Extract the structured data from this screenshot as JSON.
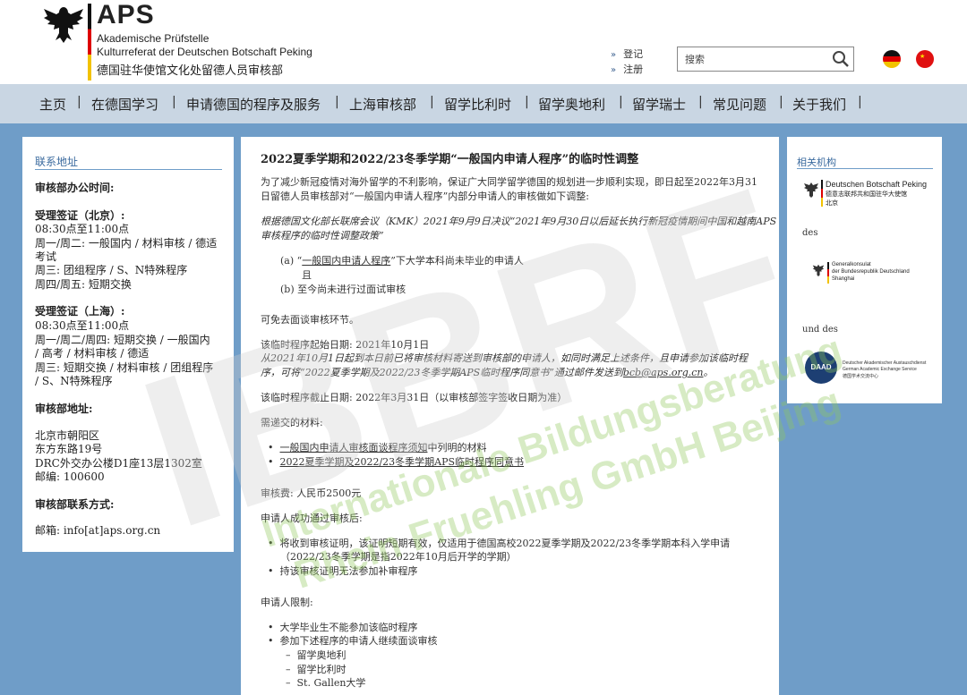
{
  "header": {
    "brand": "APS",
    "line1": "Akademische Prüfstelle",
    "line2": "Kulturreferat der Deutschen Botschaft Peking",
    "line_cn": "德国驻华使馆文化处留德人员审核部",
    "login": "登记",
    "register": "注册",
    "search_placeholder": "搜索"
  },
  "nav": [
    "主页",
    "在德国学习",
    "申请德国的程序及服务",
    "上海审核部",
    "留学比利时",
    "留学奥地利",
    "留学瑞士",
    "常见问题",
    "关于我们"
  ],
  "left": {
    "title": "联系地址",
    "office_hours": "审核部办公时间:",
    "bj_title": "受理签证（北京）:",
    "bj_time": "08:30点至11:00点",
    "bj_l1": "周一/周二: 一般国内 / 材料审核 / 德适",
    "bj_l2": "考试",
    "bj_l3": "周三: 团组程序 / S、N特殊程序",
    "bj_l4": "周四/周五: 短期交换",
    "sh_title": "受理签证（上海）:",
    "sh_time": "08:30点至11:00点",
    "sh_l1": "周一/周二/周四: 短期交换 / 一般国内",
    "sh_l2": "/ 高考 / 材料审核 / 德适",
    "sh_l3": "周三: 短期交换 / 材料审核 / 团组程序",
    "sh_l4": "/ S、N特殊程序",
    "addr_title": "审核部地址:",
    "addr1": "北京市朝阳区",
    "addr2": "东方东路19号",
    "addr3": "DRC外交办公楼D1座13层1302室",
    "addr4": "邮编:  100600",
    "contact_title": "审核部联系方式:",
    "email": "邮箱: info[at]aps.org.cn"
  },
  "main": {
    "title": "2022夏季学期和2022/23冬季学期“一般国内申请人程序”的临时性调整",
    "p1a": "为了减少新冠疫情对海外留学的不利影响，保证广大同学留学德国的规划进一步顺利实现，即日起至2022年3月31",
    "p1b": "日留德人员审核部对“一般国内申请人程序”内部分申请人的审核做如下调整:",
    "p2a": "根据德国文化部长联席会议（KMK）2021年9月9日决议“2021年9月30日以后延长执行新冠疫情期间中国和越南APS",
    "p2b": "审核程序的临时性调整政策”",
    "a_pre": "(a) “",
    "a_link": "一般国内申请人程序",
    "a_post": "”下大学本科尚未毕业的申请人",
    "and": "且",
    "b": "(b) 至今尚未进行过面试审核",
    "p3": "可免去面谈审核环节。",
    "start_label": "该临时程序起始日期:  2021年10月1日",
    "start_a": "从2021年10月1日起到本日前已将审核材料寄送到审核部的申请人，如同时满足上述条件，且申请参加该临时程",
    "start_b_pre": "序，可将“2022夏季学期及2022/23冬季学期APS临时程序同意书”通过邮件发送到",
    "start_b_link": "bcb@aps.org.cn",
    "start_b_post": "。",
    "end_label": "该临时程序截止日期:  2022年3月31日（以审核部签字签收日期为准）",
    "docs_label": "需递交的材料:",
    "doc1_link": "一般国内申请人审核面谈程序须知",
    "doc1_post": "中列明的材料",
    "doc2_link": "2022夏季学期及2022/23冬季学期APS临时程序同意书",
    "fee": "审核费:  人民币2500元",
    "after_label": "申请人成功通过审核后:",
    "after1": "将收到审核证明，该证明短期有效，仅适用于德国高校2022夏季学期及2022/23冬季学期本科入学申请",
    "after1b": "（2022/23冬季学期是指2022年10月后开学的学期）",
    "after2": "持该审核证明无法参加补审程序",
    "limit_label": "申请人限制:",
    "lim1": "大学毕业生不能参加该临时程序",
    "lim2": "参加下述程序的申请人继续面谈审核",
    "sub1": "留学奥地利",
    "sub2": "留学比利时",
    "sub3": "St. Gallen大学"
  },
  "right": {
    "title": "相关机构",
    "emb1": "Deutschen Botschaft Peking",
    "emb2": "德意志联邦共和国驻华大使馆",
    "emb3": "北京",
    "des1": "des",
    "gk1": "Generalkonsulat",
    "gk2": "der Bundesrepublik Deutschland",
    "gk3": "Shanghai",
    "des2": "und des",
    "daad": "DAAD",
    "daad1": "Deutscher Akademischer Austauschdienst",
    "daad2": "German Academic Exchange Service",
    "daad3": "德国学术交流中心"
  },
  "watermark": {
    "big": "IBBRF",
    "line1": "Internationale Bildungsberatung",
    "line2": "Rhein Fruehling GmbH Beijing"
  },
  "colors": {
    "nav_bg": "#c9d6e3",
    "page_bg": "#6f9dc8",
    "accent": "#3a6a9e",
    "watermark": "#9fd06c"
  }
}
